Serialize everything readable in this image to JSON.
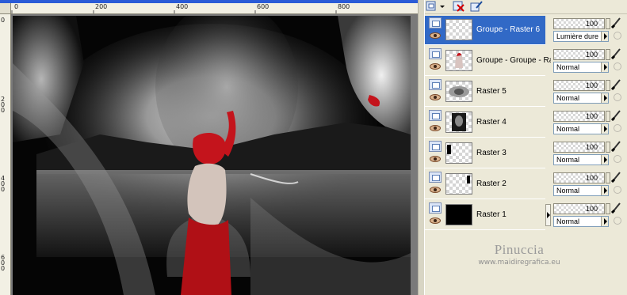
{
  "ruler": {
    "h_labels": [
      "0",
      "200",
      "400",
      "600",
      "800"
    ],
    "v_labels": [
      "0",
      "200",
      "400",
      "600"
    ]
  },
  "toolbar": {
    "buttons": [
      "new-layer-icon",
      "delete-layer-icon",
      "edit-brush-icon"
    ]
  },
  "layers": [
    {
      "name": "Groupe - Raster 6",
      "selected": true
    },
    {
      "name": "Groupe - Groupe - Ra",
      "selected": false
    },
    {
      "name": "Raster 5",
      "selected": false
    },
    {
      "name": "Raster 4",
      "selected": false
    },
    {
      "name": "Raster 3",
      "selected": false
    },
    {
      "name": "Raster 2",
      "selected": false
    },
    {
      "name": "Raster 1",
      "selected": false
    }
  ],
  "properties": [
    {
      "opacity": "100",
      "blend": "Lumière dure"
    },
    {
      "opacity": "100",
      "blend": "Normal"
    },
    {
      "opacity": "100",
      "blend": "Normal"
    },
    {
      "opacity": "100",
      "blend": "Normal"
    },
    {
      "opacity": "100",
      "blend": "Normal"
    },
    {
      "opacity": "100",
      "blend": "Normal"
    },
    {
      "opacity": "100",
      "blend": "Normal"
    }
  ],
  "watermark": {
    "name": "Pinuccia",
    "url": "www.maidiregrafica.eu"
  },
  "colors": {
    "accent": "#3169c6",
    "panel": "#ece9d8",
    "lips": "#c4141c"
  }
}
